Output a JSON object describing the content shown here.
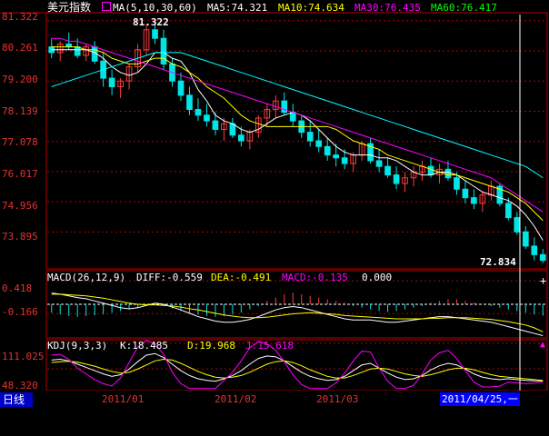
{
  "main_panel": {
    "title": "美元指数",
    "ma_label": "MA(5,10,30,60)",
    "ma5": "MA5:74.321",
    "ma10": "MA10:74.634",
    "ma30": "MA30:76.435",
    "ma60": "MA60:76.417",
    "y_labels": [
      "81.322",
      "80.261",
      "79.200",
      "78.139",
      "77.078",
      "76.017",
      "74.956",
      "73.895"
    ],
    "high_marker": "81.322",
    "low_marker": "72.834",
    "colors": {
      "up": "#ff3c3c",
      "down": "#00e6e6",
      "ma5": "#ffffff",
      "ma10": "#ffff00",
      "ma30": "#ff00ff",
      "ma60": "#00ff00",
      "grid": "#a00000"
    }
  },
  "macd_panel": {
    "label": "MACD(26,12,9)",
    "diff": "DIFF:-0.559",
    "dea": "DEA:-0.491",
    "macd": "MACD:-0.135",
    "zero": "0.000",
    "y_labels": [
      "0.418",
      "-0.166"
    ]
  },
  "kdj_panel": {
    "label": "KDJ(9,3,3)",
    "k": "K:18.485",
    "d": "D:19.968",
    "j": "J:15.618",
    "y_labels": [
      "111.025",
      "48.320"
    ]
  },
  "x_axis": {
    "period_tab": "日线",
    "ticks": [
      "2011/01",
      "2011/02",
      "2011/03"
    ],
    "cursor_date": "2011/04/25,一"
  },
  "chart_data": [
    {
      "type": "candlestick",
      "title": "美元指数",
      "ylim": [
        72.6,
        81.6
      ],
      "y_ticks": [
        81.322,
        80.261,
        79.2,
        78.139,
        77.078,
        76.017,
        74.956,
        73.895
      ],
      "ohlc": [
        [
          80.4,
          80.7,
          80.0,
          80.2
        ],
        [
          80.2,
          80.6,
          79.9,
          80.5
        ],
        [
          80.5,
          80.9,
          80.3,
          80.4
        ],
        [
          80.4,
          80.7,
          80.0,
          80.1
        ],
        [
          80.1,
          80.5,
          79.9,
          80.4
        ],
        [
          80.4,
          80.6,
          79.8,
          79.9
        ],
        [
          79.9,
          80.2,
          79.0,
          79.3
        ],
        [
          79.3,
          79.6,
          78.7,
          79.0
        ],
        [
          79.0,
          79.3,
          78.6,
          79.2
        ],
        [
          79.2,
          79.8,
          78.9,
          79.7
        ],
        [
          79.7,
          80.5,
          79.5,
          80.3
        ],
        [
          80.3,
          81.2,
          80.1,
          81.0
        ],
        [
          81.0,
          81.3,
          80.5,
          80.7
        ],
        [
          80.7,
          81.0,
          79.6,
          79.8
        ],
        [
          79.8,
          80.0,
          79.0,
          79.2
        ],
        [
          79.2,
          79.5,
          78.5,
          78.7
        ],
        [
          78.7,
          79.0,
          78.0,
          78.2
        ],
        [
          78.2,
          78.6,
          77.8,
          78.0
        ],
        [
          78.0,
          78.4,
          77.6,
          77.8
        ],
        [
          77.8,
          78.1,
          77.3,
          77.5
        ],
        [
          77.5,
          77.9,
          77.1,
          77.7
        ],
        [
          77.7,
          77.9,
          77.2,
          77.3
        ],
        [
          77.3,
          77.6,
          76.9,
          77.1
        ],
        [
          77.1,
          77.5,
          76.8,
          77.4
        ],
        [
          77.4,
          78.0,
          77.2,
          77.9
        ],
        [
          77.9,
          78.4,
          77.6,
          78.2
        ],
        [
          78.2,
          78.7,
          77.9,
          78.5
        ],
        [
          78.5,
          78.8,
          78.0,
          78.1
        ],
        [
          78.1,
          78.4,
          77.6,
          77.8
        ],
        [
          77.8,
          78.0,
          77.2,
          77.4
        ],
        [
          77.4,
          77.8,
          76.9,
          77.1
        ],
        [
          77.1,
          77.5,
          76.7,
          76.9
        ],
        [
          76.9,
          77.2,
          76.4,
          76.6
        ],
        [
          76.6,
          77.0,
          76.2,
          76.5
        ],
        [
          76.5,
          76.8,
          76.1,
          76.3
        ],
        [
          76.3,
          76.7,
          76.0,
          76.6
        ],
        [
          76.6,
          77.1,
          76.4,
          77.0
        ],
        [
          77.0,
          77.2,
          76.3,
          76.4
        ],
        [
          76.4,
          76.8,
          76.0,
          76.2
        ],
        [
          76.2,
          76.5,
          75.8,
          75.9
        ],
        [
          75.9,
          76.2,
          75.4,
          75.6
        ],
        [
          75.6,
          76.0,
          75.3,
          75.8
        ],
        [
          75.8,
          76.2,
          75.5,
          76.0
        ],
        [
          76.0,
          76.4,
          75.7,
          76.2
        ],
        [
          76.2,
          76.5,
          75.8,
          75.9
        ],
        [
          75.9,
          76.3,
          75.6,
          76.1
        ],
        [
          76.1,
          76.4,
          75.7,
          75.8
        ],
        [
          75.8,
          76.0,
          75.2,
          75.4
        ],
        [
          75.4,
          75.7,
          74.9,
          75.1
        ],
        [
          75.1,
          75.4,
          74.7,
          74.9
        ],
        [
          74.9,
          75.3,
          74.6,
          75.2
        ],
        [
          75.2,
          75.7,
          75.0,
          75.5
        ],
        [
          75.5,
          75.6,
          74.8,
          74.9
        ],
        [
          74.9,
          75.1,
          74.3,
          74.4
        ],
        [
          74.4,
          74.6,
          73.8,
          73.9
        ],
        [
          73.9,
          74.1,
          73.3,
          73.4
        ],
        [
          73.4,
          73.7,
          72.9,
          73.1
        ],
        [
          73.1,
          73.3,
          72.8,
          72.9
        ]
      ],
      "series": [
        {
          "name": "MA5",
          "values": [
            80.3,
            80.3,
            80.3,
            80.3,
            80.3,
            80.2,
            80.0,
            79.7,
            79.5,
            79.4,
            79.5,
            79.8,
            80.2,
            80.2,
            80.0,
            79.9,
            79.5,
            78.9,
            78.5,
            78.0,
            77.8,
            77.7,
            77.5,
            77.4,
            77.5,
            77.7,
            77.9,
            78.0,
            78.1,
            78.0,
            77.8,
            77.5,
            77.2,
            76.9,
            76.7,
            76.6,
            76.6,
            76.6,
            76.5,
            76.5,
            76.4,
            76.2,
            76.0,
            75.9,
            75.9,
            76.0,
            76.0,
            75.9,
            75.7,
            75.5,
            75.3,
            75.2,
            75.1,
            75.0,
            74.8,
            74.5,
            74.1,
            73.6
          ]
        },
        {
          "name": "MA10",
          "values": [
            80.4,
            80.4,
            80.4,
            80.4,
            80.3,
            80.3,
            80.2,
            80.0,
            79.9,
            79.8,
            79.8,
            79.9,
            80.0,
            80.0,
            79.8,
            79.7,
            79.5,
            79.3,
            79.0,
            78.8,
            78.6,
            78.3,
            78.0,
            77.8,
            77.7,
            77.6,
            77.6,
            77.6,
            77.6,
            77.6,
            77.6,
            77.6,
            77.6,
            77.5,
            77.3,
            77.1,
            77.0,
            76.9,
            76.8,
            76.6,
            76.5,
            76.4,
            76.3,
            76.2,
            76.1,
            76.0,
            75.9,
            75.9,
            75.8,
            75.7,
            75.6,
            75.5,
            75.4,
            75.3,
            75.1,
            74.9,
            74.6,
            74.3
          ]
        },
        {
          "name": "MA30",
          "values": [
            80.7,
            80.7,
            80.6,
            80.6,
            80.5,
            80.4,
            80.3,
            80.2,
            80.1,
            80.0,
            79.9,
            79.8,
            79.7,
            79.6,
            79.5,
            79.4,
            79.3,
            79.2,
            79.1,
            79.0,
            78.9,
            78.8,
            78.7,
            78.6,
            78.5,
            78.4,
            78.3,
            78.2,
            78.1,
            78.0,
            77.9,
            77.8,
            77.7,
            77.6,
            77.5,
            77.4,
            77.3,
            77.2,
            77.1,
            77.0,
            76.9,
            76.8,
            76.7,
            76.6,
            76.5,
            76.4,
            76.3,
            76.2,
            76.1,
            76.0,
            75.9,
            75.8,
            75.6,
            75.4,
            75.2,
            75.0,
            74.8,
            74.6
          ]
        },
        {
          "name": "MA60",
          "values": [
            79.0,
            79.1,
            79.2,
            79.3,
            79.4,
            79.5,
            79.6,
            79.7,
            79.8,
            79.9,
            80.0,
            80.1,
            80.2,
            80.2,
            80.2,
            80.2,
            80.1,
            80.0,
            79.9,
            79.8,
            79.7,
            79.6,
            79.5,
            79.4,
            79.3,
            79.2,
            79.1,
            79.0,
            78.9,
            78.8,
            78.7,
            78.6,
            78.5,
            78.4,
            78.3,
            78.2,
            78.1,
            78.0,
            77.9,
            77.8,
            77.7,
            77.6,
            77.5,
            77.4,
            77.3,
            77.2,
            77.1,
            77.0,
            76.9,
            76.8,
            76.7,
            76.6,
            76.5,
            76.4,
            76.3,
            76.2,
            76.0,
            75.8
          ]
        }
      ]
    },
    {
      "type": "bar",
      "title": "MACD(26,12,9)",
      "ylim": [
        -0.6,
        0.6
      ],
      "y_ticks": [
        0.418,
        -0.166
      ],
      "series": [
        {
          "name": "MACD",
          "values": [
            -0.1,
            -0.12,
            -0.14,
            -0.15,
            -0.14,
            -0.13,
            -0.12,
            -0.1,
            -0.08,
            -0.06,
            -0.04,
            -0.02,
            0.0,
            -0.02,
            -0.05,
            -0.08,
            -0.1,
            -0.12,
            -0.14,
            -0.15,
            -0.14,
            -0.12,
            -0.1,
            -0.06,
            -0.02,
            0.04,
            0.08,
            0.12,
            0.14,
            0.12,
            0.1,
            0.08,
            0.06,
            0.04,
            0.02,
            -0.02,
            -0.04,
            -0.06,
            -0.08,
            -0.09,
            -0.08,
            -0.06,
            -0.04,
            -0.02,
            0.02,
            0.04,
            0.06,
            0.06,
            0.04,
            0.02,
            0.0,
            -0.02,
            -0.04,
            -0.06,
            -0.08,
            -0.1,
            -0.12,
            -0.135
          ]
        },
        {
          "name": "DIFF",
          "values": [
            0.2,
            0.18,
            0.15,
            0.12,
            0.1,
            0.06,
            0.02,
            -0.02,
            -0.06,
            -0.08,
            -0.06,
            -0.02,
            0.02,
            0.0,
            -0.05,
            -0.1,
            -0.16,
            -0.22,
            -0.26,
            -0.3,
            -0.32,
            -0.32,
            -0.3,
            -0.27,
            -0.22,
            -0.16,
            -0.1,
            -0.06,
            -0.04,
            -0.06,
            -0.1,
            -0.14,
            -0.18,
            -0.22,
            -0.26,
            -0.28,
            -0.28,
            -0.28,
            -0.3,
            -0.32,
            -0.32,
            -0.3,
            -0.28,
            -0.26,
            -0.24,
            -0.22,
            -0.22,
            -0.24,
            -0.26,
            -0.28,
            -0.3,
            -0.32,
            -0.36,
            -0.4,
            -0.44,
            -0.48,
            -0.52,
            -0.559
          ]
        },
        {
          "name": "DEA",
          "values": [
            0.18,
            0.18,
            0.17,
            0.16,
            0.15,
            0.13,
            0.11,
            0.08,
            0.05,
            0.02,
            0.0,
            -0.01,
            -0.01,
            -0.02,
            -0.03,
            -0.05,
            -0.08,
            -0.1,
            -0.13,
            -0.16,
            -0.19,
            -0.21,
            -0.23,
            -0.24,
            -0.24,
            -0.23,
            -0.21,
            -0.19,
            -0.17,
            -0.16,
            -0.15,
            -0.16,
            -0.17,
            -0.18,
            -0.2,
            -0.21,
            -0.22,
            -0.23,
            -0.24,
            -0.25,
            -0.26,
            -0.26,
            -0.26,
            -0.26,
            -0.25,
            -0.25,
            -0.24,
            -0.24,
            -0.24,
            -0.25,
            -0.26,
            -0.27,
            -0.29,
            -0.31,
            -0.34,
            -0.37,
            -0.42,
            -0.491
          ]
        }
      ]
    },
    {
      "type": "line",
      "title": "KDJ(9,3,3)",
      "ylim": [
        -5,
        120
      ],
      "y_ticks": [
        111.025,
        48.32
      ],
      "series": [
        {
          "name": "K",
          "values": [
            70,
            72,
            68,
            60,
            52,
            44,
            36,
            30,
            34,
            48,
            66,
            82,
            86,
            76,
            60,
            44,
            32,
            24,
            20,
            18,
            24,
            32,
            44,
            60,
            74,
            80,
            78,
            68,
            54,
            40,
            30,
            24,
            20,
            22,
            30,
            44,
            58,
            62,
            50,
            38,
            28,
            22,
            24,
            32,
            46,
            56,
            62,
            58,
            48,
            36,
            28,
            24,
            22,
            24,
            22,
            20,
            19,
            18.485
          ]
        },
        {
          "name": "D",
          "values": [
            64,
            66,
            67,
            65,
            60,
            55,
            48,
            42,
            38,
            40,
            48,
            58,
            68,
            72,
            70,
            62,
            52,
            42,
            34,
            28,
            26,
            28,
            32,
            40,
            50,
            60,
            66,
            68,
            64,
            56,
            46,
            38,
            30,
            26,
            26,
            32,
            40,
            48,
            50,
            48,
            42,
            36,
            32,
            30,
            34,
            40,
            46,
            50,
            50,
            46,
            40,
            34,
            30,
            28,
            26,
            24,
            22,
            19.968
          ]
        },
        {
          "name": "J",
          "values": [
            82,
            84,
            72,
            50,
            36,
            22,
            12,
            6,
            26,
            64,
            102,
            118,
            110,
            84,
            40,
            12,
            0,
            0,
            0,
            0,
            20,
            40,
            68,
            100,
            116,
            110,
            94,
            66,
            34,
            10,
            0,
            0,
            0,
            14,
            38,
            68,
            92,
            90,
            50,
            18,
            0,
            0,
            8,
            36,
            70,
            88,
            94,
            74,
            44,
            16,
            4,
            4,
            6,
            16,
            14,
            12,
            13,
            15.618
          ]
        }
      ]
    }
  ]
}
